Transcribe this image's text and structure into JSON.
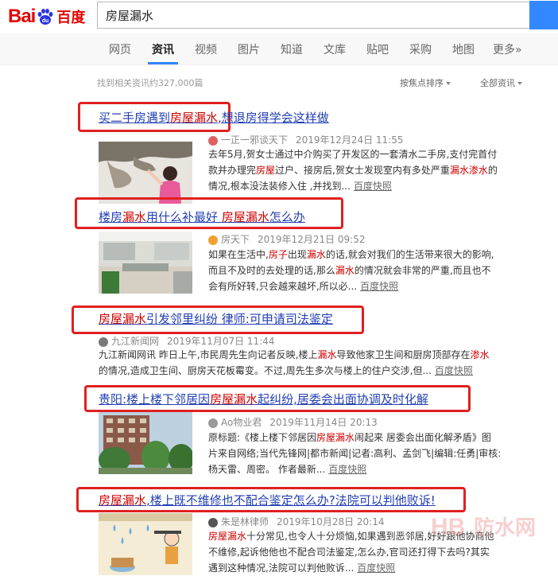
{
  "header": {
    "logo_text": "Bai",
    "logo_cn": "百度",
    "search_value": "房屋漏水"
  },
  "nav": {
    "tabs": [
      {
        "label": "网页"
      },
      {
        "label": "资讯"
      },
      {
        "label": "视频"
      },
      {
        "label": "图片"
      },
      {
        "label": "知道"
      },
      {
        "label": "文库"
      },
      {
        "label": "贴吧"
      },
      {
        "label": "采购"
      },
      {
        "label": "地图"
      },
      {
        "label": "更多»"
      }
    ]
  },
  "stats": {
    "text": "找到相关资讯约327,000篇",
    "sort_label": "按焦点排序",
    "range_label": "全部资讯"
  },
  "results": [
    {
      "title_parts": [
        "买二手房遇到",
        "房屋漏水",
        ",想退房得学会这样做"
      ],
      "source": "一正一邪谈天下",
      "time": "2019年12月24日 11:55",
      "abs_lines": [
        [
          "去年5月,贺女士通过中介购买了开发区的一套清水二手房,支付完首付"
        ],
        [
          "款并办理完",
          "房屋",
          "过户、接房后,贺女士发现室内有多处严重",
          "漏水",
          "渗水",
          "的"
        ],
        [
          "情况,根本没法装修入住 ,并找到..."
        ]
      ],
      "snapshot": "百度快照"
    },
    {
      "title_parts": [
        "楼房",
        "漏水",
        "用什么补最好 ",
        "房屋漏水",
        "怎么办"
      ],
      "source": "房天下",
      "time": "2019年12月21日 09:52",
      "abs_lines": [
        [
          "如果在生活中,",
          "房子",
          "出现",
          "漏水",
          "的话,就会对我们的生活带来很大的影响,"
        ],
        [
          "而且不及时的去处理的话,那么",
          "漏水",
          "的情况就会非常的严重,而且也不"
        ],
        [
          "会有所好转,只会越来越坏,所以必..."
        ]
      ],
      "snapshot": "百度快照"
    },
    {
      "title_parts": [
        "房屋漏水",
        "引发邻里纠纷 律师:可申请司法鉴定"
      ],
      "source": "九江新闻网",
      "time": "2019年11月07日 11:44",
      "abs_lines": [
        [
          "九江新闻网讯 昨日上午,市民周先生向记者反映,楼上",
          "漏水",
          "导致他家卫生间和厨房顶部存在",
          "渗水"
        ],
        [
          "的情况,造成卫生间、厨房天花板霉变。不过,周先生多次与楼上的住户交涉,但..."
        ]
      ],
      "snapshot": "百度快照"
    },
    {
      "title_parts": [
        "贵阳:楼上楼下邻居因",
        "房屋漏水",
        "起纠纷,居委会出面协调及时化解"
      ],
      "source": "Ao物业君",
      "time": "2019年11月14日 20:13",
      "abs_lines": [
        [
          "原标题:《楼上楼下邻居因",
          "房屋漏水",
          "闹起来 居委会出面化解矛盾》图"
        ],
        [
          "片来自网络;当代先锋网|都市新闻|记者:高利、孟剑飞|编辑:任勇|审核:"
        ],
        [
          "杨天雷、周密。  作者最新..."
        ]
      ],
      "snapshot": "百度快照"
    },
    {
      "title_parts": [
        "房屋漏水",
        ",楼上既不维修也不配合鉴定怎么办?法院可以判他败诉!"
      ],
      "source": "朱是林律师",
      "time": "2019年10月28日 20:14",
      "abs_lines": [
        [
          "房屋漏水",
          "十分常见,也令人十分烦恼,如果遇到恶邻居,好好跟他协商他"
        ],
        [
          "不维修,起诉他他也不配合司法鉴定,怎么办,官司还打得下去吗?其实"
        ],
        [
          "遇到这种情况,法院可以判他败诉..."
        ]
      ],
      "snapshot": "百度快照"
    }
  ],
  "colors": {
    "link": "#2440b3",
    "keyword": "#cc0000",
    "brand_red": "#e10602",
    "brand_blue": "#2932e1",
    "annotation_red": "#e02020"
  },
  "watermark": {
    "text_latin": "HB",
    "text_cn": "防水网"
  }
}
